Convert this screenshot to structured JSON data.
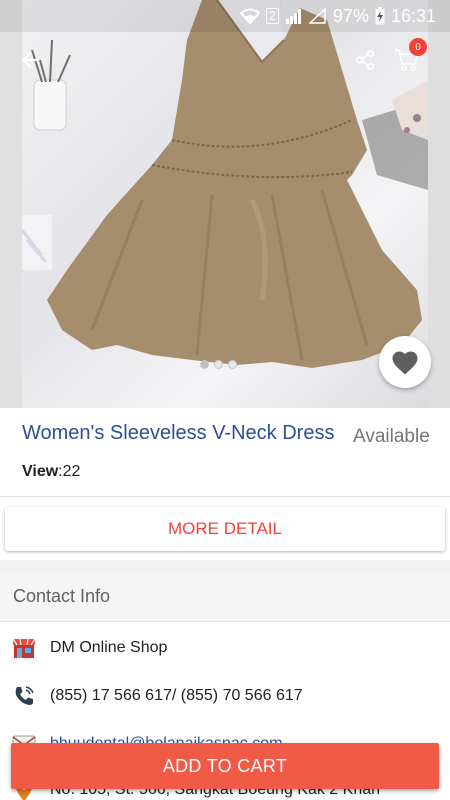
{
  "status_bar": {
    "sim": "2",
    "battery": "97%",
    "time": "16:31"
  },
  "toolbar": {
    "cart_count": "0"
  },
  "gallery": {
    "page_count": 3,
    "active_index": 0
  },
  "product": {
    "title": "Women's Sleeveless V-Neck Dress",
    "availability": "Available",
    "view_label": "View",
    "view_separator": ":",
    "view_count": "22"
  },
  "actions": {
    "more_detail": "MORE DETAIL",
    "add_to_cart": "ADD TO CART"
  },
  "contact": {
    "header": "Contact Info",
    "shop_name": "DM Online Shop",
    "phone": "(855) 17 566 617/ (855) 70 566 617",
    "email": "bhuudental@belanaikasnac.com",
    "address": "No. 105, St. 566, Sangkat Boeung Kak 2 Khan"
  },
  "colors": {
    "accent_red": "#f44336",
    "title_blue": "#2b4e9a",
    "cart_button": "#f15a47"
  }
}
